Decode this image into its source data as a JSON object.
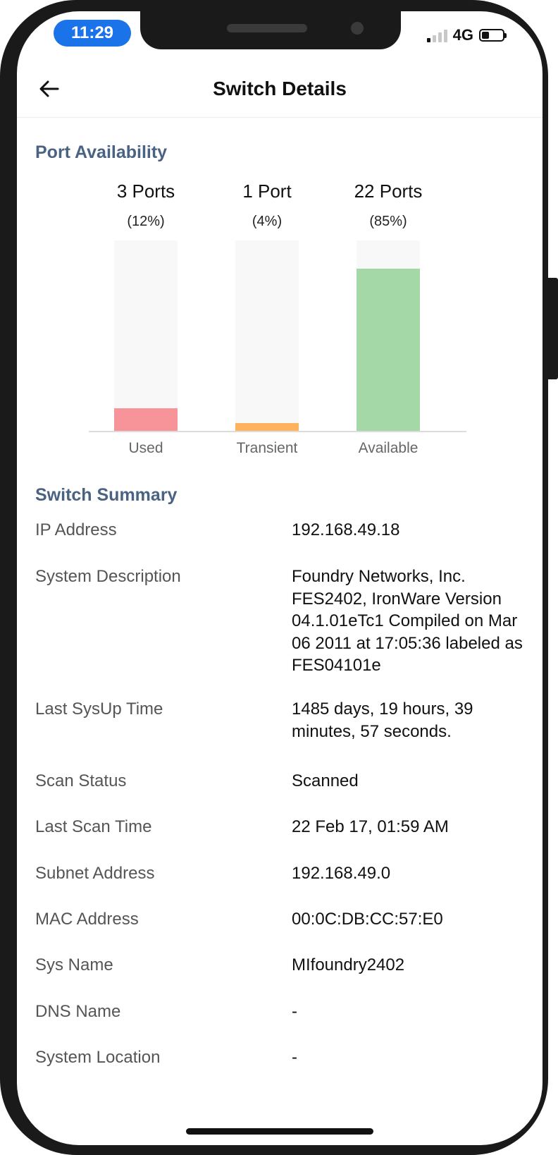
{
  "status_bar": {
    "time": "11:29",
    "network": "4G",
    "signal_bars_active": 1,
    "signal_bars_total": 4,
    "battery_level": 0.35
  },
  "header": {
    "title": "Switch Details",
    "back_icon": "arrow-left-icon"
  },
  "port_availability": {
    "section_title": "Port Availability"
  },
  "chart_data": {
    "type": "bar",
    "categories": [
      "Used",
      "Transient",
      "Available"
    ],
    "count_labels": [
      "3 Ports",
      "1 Port",
      "22 Ports"
    ],
    "percent_labels": [
      "(12%)",
      "(4%)",
      "(85%)"
    ],
    "values": [
      3,
      1,
      22
    ],
    "percents": [
      12,
      4,
      85
    ],
    "colors": [
      "#f7949a",
      "#ffb15c",
      "#a5d8a7"
    ],
    "track_color": "#f8f8f8",
    "ylim": [
      0,
      100
    ]
  },
  "switch_summary": {
    "section_title": "Switch Summary",
    "rows": [
      {
        "label": "IP Address",
        "value": "192.168.49.18"
      },
      {
        "label": "System Description",
        "value": "Foundry Networks, Inc. FES2402, IronWare Version 04.1.01eTc1 Compiled on Mar 06 2011 at 17:05:36 labeled as FES04101e"
      },
      {
        "label": "Last SysUp Time",
        "value": "1485 days, 19 hours, 39 minutes, 57 seconds."
      },
      {
        "label": "Scan Status",
        "value": "Scanned"
      },
      {
        "label": "Last Scan Time",
        "value": "22 Feb 17, 01:59 AM"
      },
      {
        "label": "Subnet Address",
        "value": "192.168.49.0"
      },
      {
        "label": "MAC Address",
        "value": "00:0C:DB:CC:57:E0"
      },
      {
        "label": "Sys Name",
        "value": "MIfoundry2402"
      },
      {
        "label": "DNS Name",
        "value": "-"
      },
      {
        "label": "System Location",
        "value": "-"
      }
    ]
  },
  "colors": {
    "section_title": "#4a6382",
    "time_pill": "#1a73e8"
  }
}
